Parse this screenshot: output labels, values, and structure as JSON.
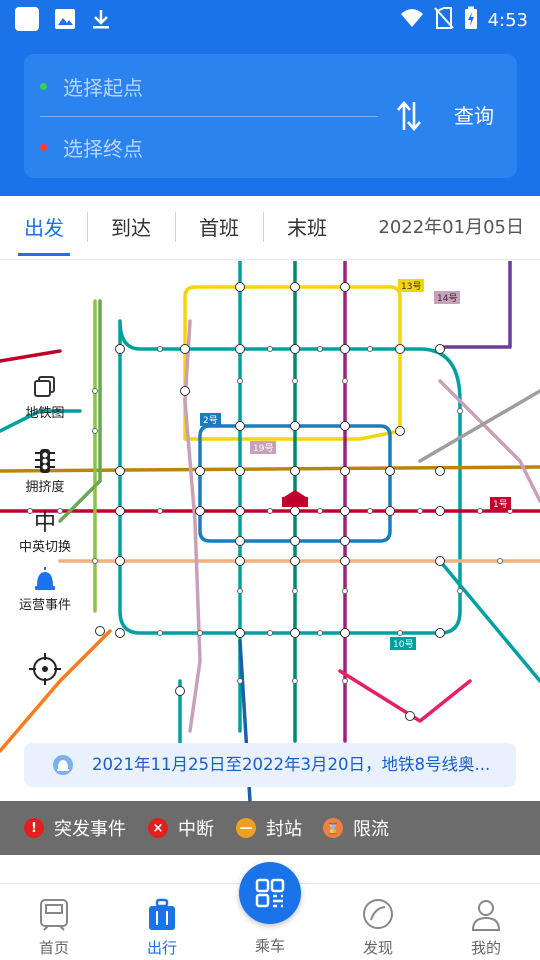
{
  "status_bar": {
    "time": "4:53",
    "left_icons": [
      "app-square-icon",
      "image-icon",
      "download-icon"
    ],
    "right_icons": [
      "wifi-icon",
      "no-sim-icon",
      "battery-charging-icon"
    ]
  },
  "route_search": {
    "origin_placeholder": "选择起点",
    "destination_placeholder": "选择终点",
    "query_label": "查询",
    "origin_dot_color": "#3ccf4e",
    "destination_dot_color": "#ff3b30"
  },
  "tabs": {
    "items": [
      {
        "label": "出发",
        "active": true
      },
      {
        "label": "到达",
        "active": false
      },
      {
        "label": "首班",
        "active": false
      },
      {
        "label": "末班",
        "active": false
      }
    ],
    "date": "2022年01月05日"
  },
  "map_tools": [
    {
      "label": "地铁图",
      "icon": "layers-icon"
    },
    {
      "label": "拥挤度",
      "icon": "traffic-light-icon"
    },
    {
      "label": "中英切换",
      "icon": "language-toggle-icon",
      "glyph": "中"
    },
    {
      "label": "运营事件",
      "icon": "alarm-bell-icon"
    }
  ],
  "map": {
    "line_badges": [
      {
        "label": "13号"
      },
      {
        "label": "14号"
      },
      {
        "label": "2号"
      },
      {
        "label": "19号"
      },
      {
        "label": "1号"
      },
      {
        "label": "10号"
      }
    ],
    "lines": [
      {
        "color": "#f5d40a"
      },
      {
        "color": "#1a7bbf"
      },
      {
        "color": "#6a3d9a"
      },
      {
        "color": "#00a0a0"
      },
      {
        "color": "#c0002a"
      },
      {
        "color": "#e8b24a"
      },
      {
        "color": "#8bc34a"
      },
      {
        "color": "#e91e63"
      },
      {
        "color": "#ff7a1a"
      },
      {
        "color": "#9e9e9e"
      },
      {
        "color": "#c9a0b9"
      }
    ]
  },
  "notice": {
    "text": "2021年11月25日至2022年3月20日，地铁8号线奥..."
  },
  "legend": [
    {
      "label": "突发事件",
      "color": "#e02020",
      "glyph": "!"
    },
    {
      "label": "中断",
      "color": "#e02020",
      "glyph": "×"
    },
    {
      "label": "封站",
      "color": "#f0a020",
      "glyph": "—"
    },
    {
      "label": "限流",
      "color": "#f08040",
      "glyph": "⌛"
    }
  ],
  "bottom_nav": {
    "items": [
      {
        "label": "首页",
        "active": false,
        "icon": "home-train-icon"
      },
      {
        "label": "出行",
        "active": true,
        "icon": "luggage-icon"
      },
      {
        "label": "乘车",
        "active": false,
        "icon": "qr-code-icon"
      },
      {
        "label": "发现",
        "active": false,
        "icon": "compass-icon"
      },
      {
        "label": "我的",
        "active": false,
        "icon": "person-icon"
      }
    ]
  },
  "colors": {
    "brand_blue": "#1a73e8",
    "search_card": "#2b83f0",
    "legend_bar": "#5f5f5f"
  }
}
